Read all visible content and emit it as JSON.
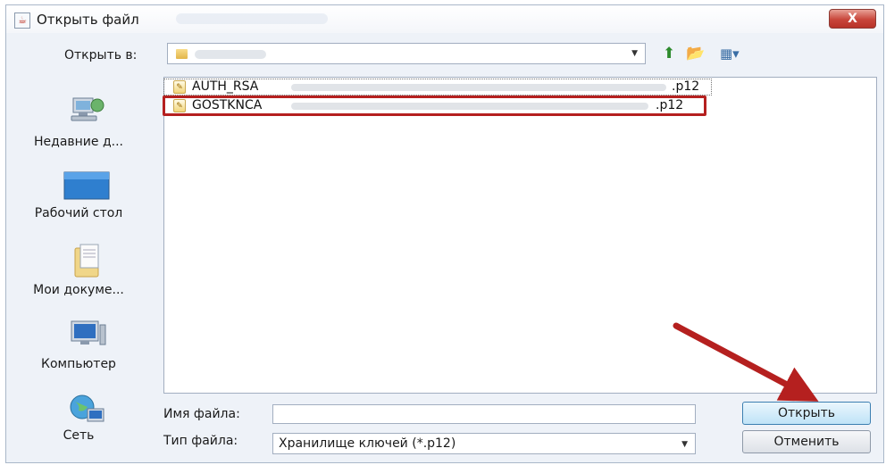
{
  "window": {
    "title": "Открыть файл",
    "close_label": "X"
  },
  "lookin": {
    "label": "Открыть в:"
  },
  "places": [
    {
      "label": "Недавние д...",
      "icon": "recent-documents-icon"
    },
    {
      "label": "Рабочий стол",
      "icon": "desktop-icon"
    },
    {
      "label": "Мои докуме...",
      "icon": "my-documents-icon"
    },
    {
      "label": "Компьютер",
      "icon": "computer-icon"
    },
    {
      "label": "Сеть",
      "icon": "network-icon"
    }
  ],
  "files": [
    {
      "name": "AUTH_RSA",
      "ext": ".p12",
      "icon": "certificate-file-icon"
    },
    {
      "name": "GOSTKNCA",
      "ext": ".p12",
      "icon": "certificate-file-icon",
      "highlighted": true
    }
  ],
  "form": {
    "filename_label": "Имя файла:",
    "filename_value": "",
    "filetype_label": "Тип файла:",
    "filetype_value": "Хранилище ключей (*.p12)"
  },
  "buttons": {
    "open": "Открыть",
    "cancel": "Отменить"
  },
  "colors": {
    "highlight_box": "#b5201f",
    "annotation_arrow": "#b5201f",
    "primary_button": "#bfe3f7"
  }
}
